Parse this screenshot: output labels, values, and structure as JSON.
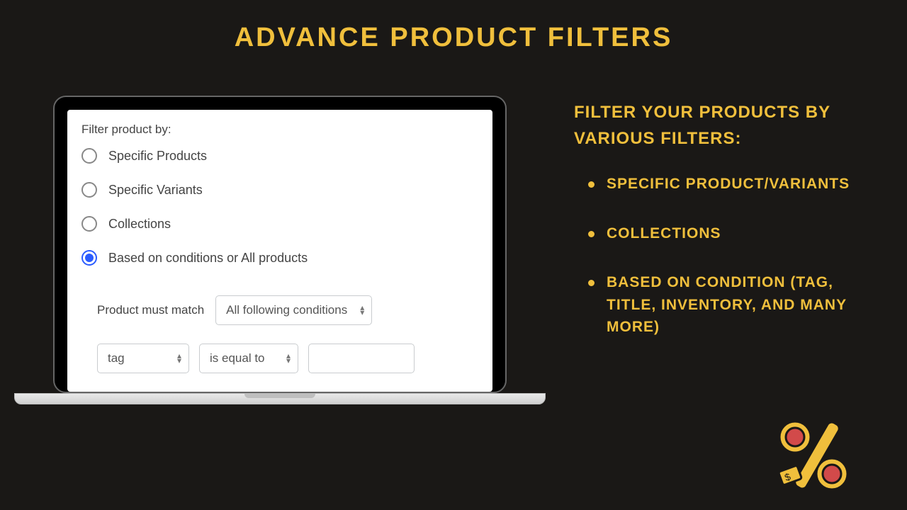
{
  "title": "Advance Product Filters",
  "laptop": {
    "section_label": "Filter product by:",
    "radios": [
      {
        "label": "Specific Products",
        "selected": false
      },
      {
        "label": "Specific Variants",
        "selected": false
      },
      {
        "label": "Collections",
        "selected": false
      },
      {
        "label": "Based on conditions or All products",
        "selected": true
      }
    ],
    "match_label": "Product must match",
    "match_select": "All following conditions",
    "cond_field": "tag",
    "cond_op": "is equal to",
    "cond_value": ""
  },
  "side": {
    "heading": "Filter your products by various filters:",
    "bullets": [
      "Specific Product/Variants",
      "Collections",
      "Based on Condition (Tag, Title, Inventory, and many more)"
    ]
  },
  "colors": {
    "accent": "#f0bf3c",
    "bg": "#1a1816",
    "radio_selected": "#2b5cff"
  }
}
